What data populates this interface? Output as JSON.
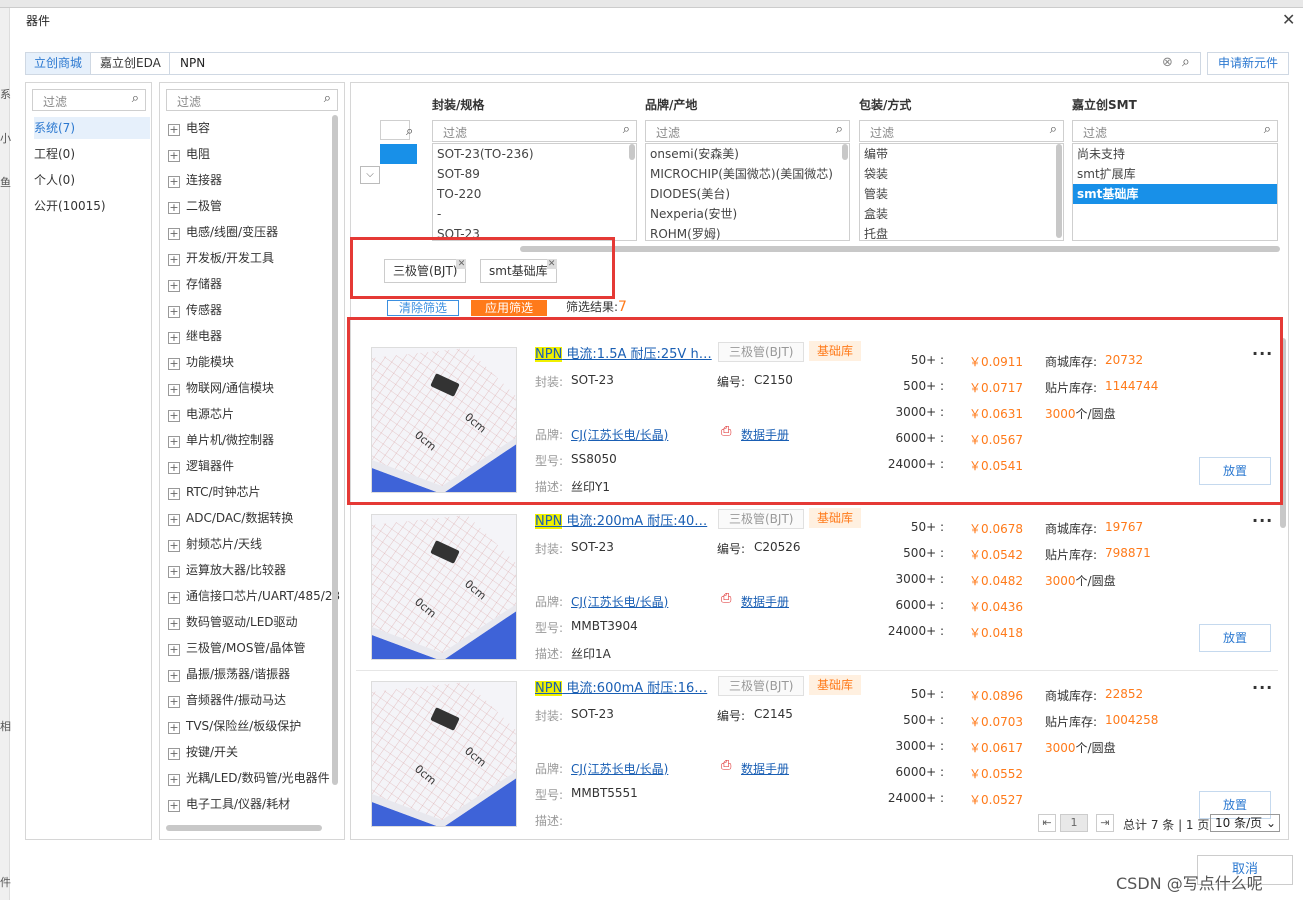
{
  "window": {
    "title": "器件",
    "close_glyph": "✕"
  },
  "left_strip": [
    "系",
    "小",
    "鱼",
    "相",
    "件"
  ],
  "search": {
    "tabs": [
      "立创商城",
      "嘉立创EDA"
    ],
    "query": "NPN",
    "apply_new": "申请新元件"
  },
  "libraries": {
    "filter_placeholder": "过滤",
    "items": [
      "系统(7)",
      "工程(0)",
      "个人(0)",
      "公开(10015)"
    ]
  },
  "categories": {
    "filter_placeholder": "过滤",
    "items": [
      "电容",
      "电阻",
      "连接器",
      "二极管",
      "电感/线圈/变压器",
      "开发板/开发工具",
      "存储器",
      "传感器",
      "继电器",
      "功能模块",
      "物联网/通信模块",
      "电源芯片",
      "单片机/微控制器",
      "逻辑器件",
      "RTC/时钟芯片",
      "ADC/DAC/数据转换",
      "射频芯片/天线",
      "运算放大器/比较器",
      "通信接口芯片/UART/485/23",
      "数码管驱动/LED驱动",
      "三极管/MOS管/晶体管",
      "晶振/振荡器/谐振器",
      "音频器件/振动马达",
      "TVS/保险丝/板级保护",
      "按键/开关",
      "光耦/LED/数码管/光电器件",
      "电子工具/仪器/耗材"
    ]
  },
  "filters": {
    "columns": [
      {
        "header": "封装/规格",
        "placeholder": "过滤",
        "items": [
          "SOT-23(TO-236)",
          "SOT-89",
          "TO-220",
          "-",
          "SOT-23"
        ]
      },
      {
        "header": "品牌/产地",
        "placeholder": "过滤",
        "items": [
          "onsemi(安森美)",
          "MICROCHIP(美国微芯)(美国微芯)",
          "DIODES(美台)",
          "Nexperia(安世)",
          "ROHM(罗姆)"
        ]
      },
      {
        "header": "包装/方式",
        "placeholder": "过滤",
        "items": [
          "编带",
          "袋装",
          "管装",
          "盒装",
          "托盘"
        ]
      },
      {
        "header": "嘉立创SMT",
        "placeholder": "过滤",
        "items": [
          "尚未支持",
          "smt扩展库",
          "smt基础库"
        ]
      }
    ],
    "chips": [
      "三极管(BJT)",
      "smt基础库"
    ],
    "clear_label": "清除筛选",
    "apply_label": "应用筛选",
    "result_label": "筛选结果:",
    "result_count": "7"
  },
  "products": [
    {
      "title_hl": "NPN",
      "title_rest": " 电流:1.5A 耐压:25V h…",
      "badge_type": "三极管(BJT)",
      "badge_lib": "基础库",
      "package": "SOT-23",
      "code": "C2150",
      "brand": "CJ(江苏长电/长晶)",
      "datasheet": "数据手册",
      "model": "SS8050",
      "desc": "丝印Y1",
      "tiers": [
        {
          "q": "50+ :",
          "p": "￥0.0911"
        },
        {
          "q": "500+ :",
          "p": "￥0.0717"
        },
        {
          "q": "3000+ :",
          "p": "￥0.0631"
        },
        {
          "q": "6000+ :",
          "p": "￥0.0567"
        },
        {
          "q": "24000+ :",
          "p": "￥0.0541"
        }
      ],
      "mall_stock": "20732",
      "smt_stock": "1144744",
      "reel": "3000"
    },
    {
      "title_hl": "NPN",
      "title_rest": " 电流:200mA 耐压:40…",
      "badge_type": "三极管(BJT)",
      "badge_lib": "基础库",
      "package": "SOT-23",
      "code": "C20526",
      "brand": "CJ(江苏长电/长晶)",
      "datasheet": "数据手册",
      "model": "MMBT3904",
      "desc": "丝印1A",
      "tiers": [
        {
          "q": "50+ :",
          "p": "￥0.0678"
        },
        {
          "q": "500+ :",
          "p": "￥0.0542"
        },
        {
          "q": "3000+ :",
          "p": "￥0.0482"
        },
        {
          "q": "6000+ :",
          "p": "￥0.0436"
        },
        {
          "q": "24000+ :",
          "p": "￥0.0418"
        }
      ],
      "mall_stock": "19767",
      "smt_stock": "798871",
      "reel": "3000"
    },
    {
      "title_hl": "NPN",
      "title_rest": " 电流:600mA 耐压:16…",
      "badge_type": "三极管(BJT)",
      "badge_lib": "基础库",
      "package": "SOT-23",
      "code": "C2145",
      "brand": "CJ(江苏长电/长晶)",
      "datasheet": "数据手册",
      "model": "MMBT5551",
      "desc": "",
      "tiers": [
        {
          "q": "50+ :",
          "p": "￥0.0896"
        },
        {
          "q": "500+ :",
          "p": "￥0.0703"
        },
        {
          "q": "3000+ :",
          "p": "￥0.0617"
        },
        {
          "q": "6000+ :",
          "p": "￥0.0552"
        },
        {
          "q": "24000+ :",
          "p": "￥0.0527"
        }
      ],
      "mall_stock": "22852",
      "smt_stock": "1004258",
      "reel": "3000"
    }
  ],
  "labels": {
    "package": "封装:",
    "code": "编号:",
    "brand": "品牌:",
    "model": "型号:",
    "desc": "描述:",
    "mall_stock": "商城库存:",
    "smt_stock": "贴片库存:",
    "reel_suffix": "个/圆盘",
    "place": "放置",
    "more": "···"
  },
  "pager": {
    "page": "1",
    "summary": "总计 7 条 | 1 页",
    "per_page": "10 条/页"
  },
  "footer": {
    "cancel": "取消",
    "watermark": "CSDN @写点什么呢"
  },
  "colors": {
    "accent": "#2b78d0",
    "orange": "#ff7a1a",
    "selected": "#1890e8",
    "highlight_box": "#e53935"
  }
}
